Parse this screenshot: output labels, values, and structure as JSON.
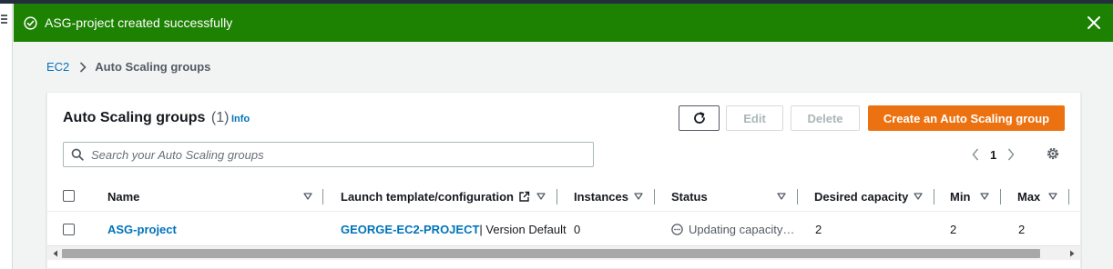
{
  "flash": {
    "message": "ASG-project created successfully",
    "color": "#1d8102"
  },
  "breadcrumb": {
    "root": "EC2",
    "current": "Auto Scaling groups"
  },
  "panel": {
    "title": "Auto Scaling groups",
    "count": "(1)",
    "info": "Info"
  },
  "actions": {
    "edit": "Edit",
    "delete": "Delete",
    "create": "Create an Auto Scaling group",
    "create_color": "#ec7211"
  },
  "search": {
    "placeholder": "Search your Auto Scaling groups"
  },
  "pagination": {
    "page": "1"
  },
  "table": {
    "columns": [
      "Name",
      "Launch template/configuration",
      "Instances",
      "Status",
      "Desired capacity",
      "Min",
      "Max"
    ],
    "rows": [
      {
        "name": "ASG-project",
        "launch_template": "GEORGE-EC2-PROJECT",
        "launch_version": " | Version Default",
        "instances": "0",
        "status": "Updating capacity…",
        "desired_capacity": "2",
        "min": "2",
        "max": "2"
      }
    ]
  }
}
